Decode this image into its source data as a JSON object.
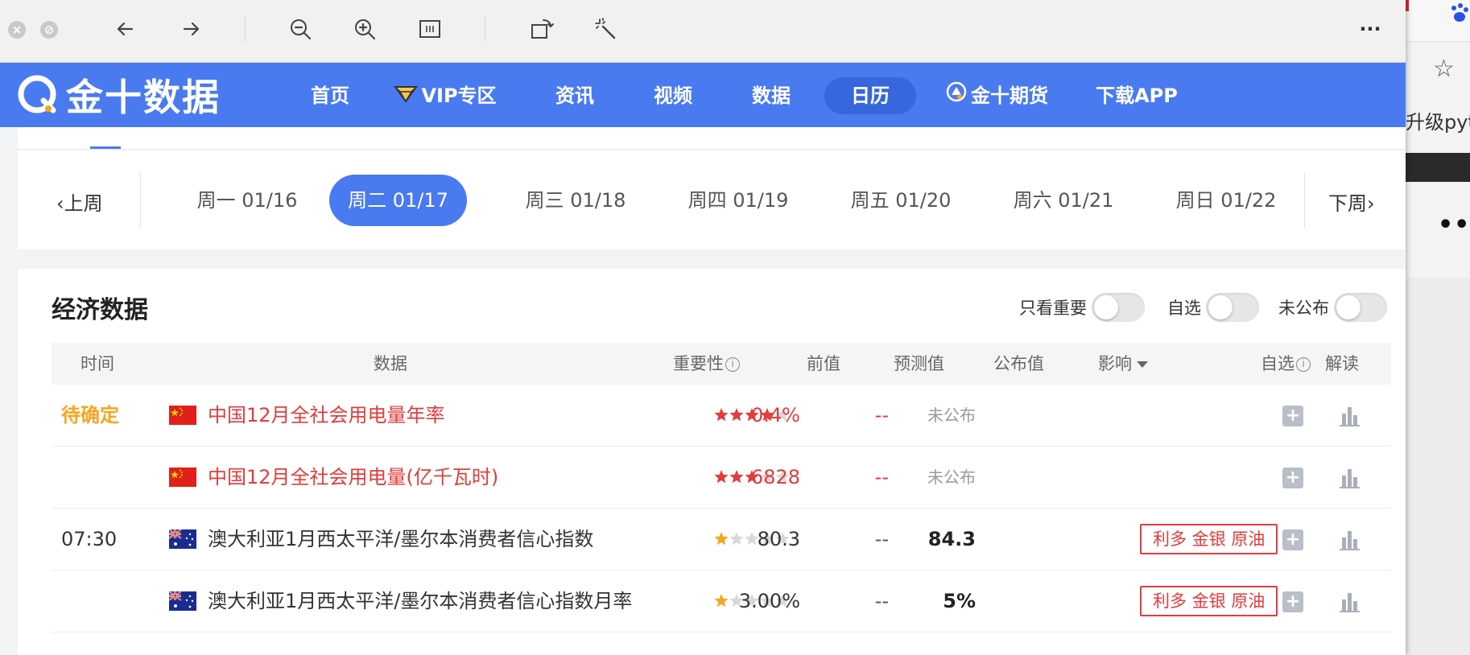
{
  "browser": {
    "toolbar": {
      "back_icon": "arrow-left-icon",
      "forward_icon": "arrow-right-icon",
      "zoom_out_icon": "zoom-out-icon",
      "zoom_in_icon": "zoom-in-icon",
      "reader_icon": "reader-mode-icon",
      "rotate_icon": "rotate-icon",
      "magic_icon": "magic-wand-icon",
      "more_icon": "more-horizontal-icon",
      "more_label": "···"
    }
  },
  "background_window": {
    "text_fragment": "升级pyth",
    "more_label": "•••"
  },
  "site": {
    "logo_text": "金十数据",
    "nav": [
      {
        "label": "首页"
      },
      {
        "label": "VIP专区"
      },
      {
        "label": "资讯"
      },
      {
        "label": "视频"
      },
      {
        "label": "数据"
      },
      {
        "label": "日历",
        "active": true
      },
      {
        "label": "金十期货"
      },
      {
        "label": "下载APP"
      }
    ],
    "brand_color": "#4a7af0"
  },
  "datenav": {
    "prev_week": "上周",
    "next_week": "下周",
    "days": [
      {
        "label": "周一 01/16"
      },
      {
        "label": "周二 01/17",
        "active": true
      },
      {
        "label": "周三 01/18"
      },
      {
        "label": "周四 01/19"
      },
      {
        "label": "周五 01/20"
      },
      {
        "label": "周六 01/21"
      },
      {
        "label": "周日 01/22"
      }
    ]
  },
  "econ": {
    "title": "经济数据",
    "filters": [
      {
        "label": "只看重要",
        "on": false
      },
      {
        "label": "自选",
        "on": false
      },
      {
        "label": "未公布",
        "on": false
      }
    ],
    "columns": {
      "time": "时间",
      "data": "数据",
      "importance": "重要性",
      "previous": "前值",
      "forecast": "预测值",
      "actual": "公布值",
      "impact": "影响",
      "watchlist": "自选",
      "analysis": "解读"
    },
    "rows": [
      {
        "time": "待确定",
        "flag": "cn",
        "name": "中国12月全社会用电量年率",
        "stars": 4,
        "previous": "0.4%",
        "forecast": "--",
        "actual": "未公布",
        "impact": "",
        "highlight": true
      },
      {
        "time": "",
        "flag": "cn",
        "name": "中国12月全社会用电量(亿千瓦时)",
        "stars": 3,
        "previous": "6828",
        "forecast": "--",
        "actual": "未公布",
        "impact": "",
        "highlight": true
      },
      {
        "time": "07:30",
        "flag": "au",
        "name": "澳大利亚1月西太平洋/墨尔本消费者信心指数",
        "stars": 1,
        "previous": "80.3",
        "forecast": "--",
        "actual": "84.3",
        "impact": "利多 金银 原油",
        "highlight": false
      },
      {
        "time": "",
        "flag": "au",
        "name": "澳大利亚1月西太平洋/墨尔本消费者信心指数月率",
        "stars": 1,
        "previous": "3.00%",
        "forecast": "--",
        "actual": "5%",
        "impact": "利多 金银 原油",
        "highlight": false
      }
    ],
    "add_icon": "plus-square-icon",
    "analysis_icon": "bar-chart-icon",
    "star_color": "#e23c3c",
    "star_color_low": "#f5a623",
    "impact_color": "#e23c3c"
  }
}
